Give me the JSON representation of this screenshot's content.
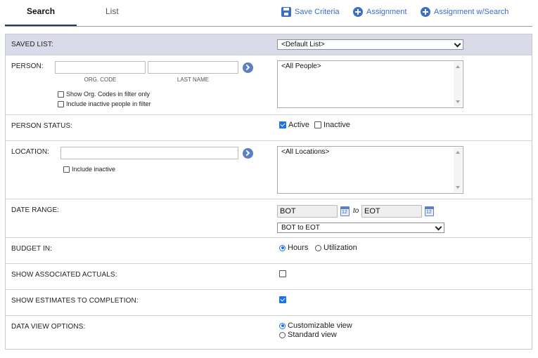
{
  "tabs": [
    {
      "label": "Search",
      "active": true
    },
    {
      "label": "List",
      "active": false
    }
  ],
  "actions": {
    "save_criteria": "Save Criteria",
    "assignment": "Assignment",
    "assignment_search": "Assignment w/Search"
  },
  "colors": {
    "accent": "#3a6fc4",
    "header_row_bg": "#d9dbe8",
    "check_blue": "#1a73e8"
  },
  "saved_list": {
    "label": "SAVED LIST:",
    "selected": "<Default List>"
  },
  "person": {
    "label": "PERSON:",
    "org_code_value": "",
    "last_name_value": "",
    "org_code_caption": "ORG. CODE",
    "last_name_caption": "LAST NAME",
    "show_org_codes": {
      "label": "Show Org. Codes in filter only",
      "checked": false
    },
    "include_inactive": {
      "label": "Include inactive people in filter",
      "checked": false
    },
    "list_selected": "<All People>"
  },
  "person_status": {
    "label": "PERSON STATUS:",
    "active": {
      "label": "Active",
      "checked": true
    },
    "inactive": {
      "label": "Inactive",
      "checked": false
    }
  },
  "location": {
    "label": "LOCATION:",
    "value": "",
    "include_inactive": {
      "label": "Include inactive",
      "checked": false
    },
    "list_selected": "<All Locations>"
  },
  "date_range": {
    "label": "DATE RANGE:",
    "from": "BOT",
    "to_word": "to",
    "to": "EOT",
    "calendar_glyph": "12",
    "preset_selected": "BOT to EOT"
  },
  "budget_in": {
    "label": "BUDGET IN:",
    "hours": {
      "label": "Hours",
      "selected": true
    },
    "utilization": {
      "label": "Utilization",
      "selected": false
    }
  },
  "show_actuals": {
    "label": "SHOW ASSOCIATED ACTUALS:",
    "checked": false
  },
  "show_estimates": {
    "label": "SHOW ESTIMATES TO COMPLETION:",
    "checked": true
  },
  "data_view": {
    "label": "DATA VIEW OPTIONS:",
    "customizable": {
      "label": "Customizable view",
      "selected": true
    },
    "standard": {
      "label": "Standard view",
      "selected": false
    }
  }
}
